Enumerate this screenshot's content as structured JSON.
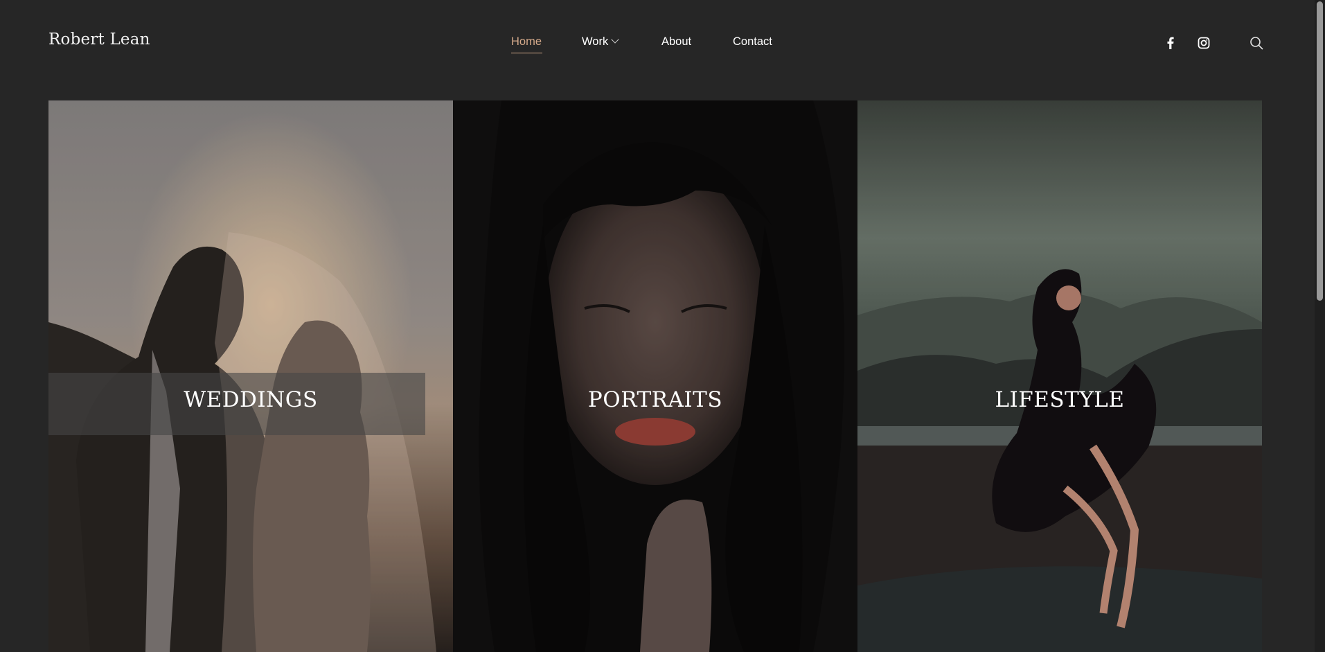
{
  "site": {
    "title": "Robert Lean"
  },
  "nav": {
    "items": [
      {
        "label": "Home",
        "active": true
      },
      {
        "label": "Work",
        "has_dropdown": true
      },
      {
        "label": "About"
      },
      {
        "label": "Contact"
      }
    ]
  },
  "header_icons": [
    "facebook-icon",
    "instagram-icon",
    "search-icon"
  ],
  "gallery": {
    "panels": [
      {
        "label": "WEDDINGS"
      },
      {
        "label": "PORTRAITS"
      },
      {
        "label": "LIFESTYLE"
      }
    ]
  },
  "colors": {
    "background": "#262626",
    "accent": "#d4a98a",
    "text": "#ffffff"
  }
}
